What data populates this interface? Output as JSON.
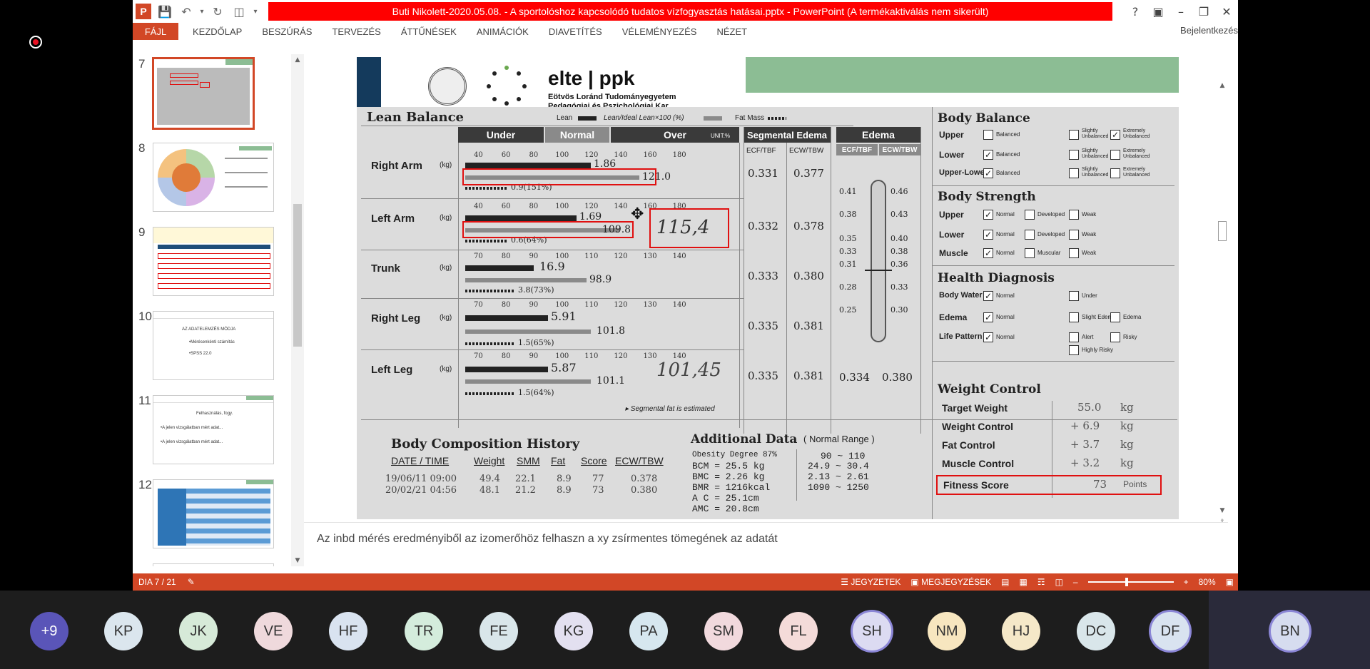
{
  "window": {
    "title": "Buti Nikolett-2020.05.08. - A sportolóshoz kapcsolódó tudatos vízfogyasztás hatásai.pptx - PowerPoint (A termékaktiválás nem sikerült)",
    "help": "?",
    "signin": "Bejelentkezés"
  },
  "ribbon": {
    "tabs": [
      "FÁJL",
      "KEZDŐLAP",
      "BESZÚRÁS",
      "TERVEZÉS",
      "ÁTTŰNÉSEK",
      "ANIMÁCIÓK",
      "DIAVETÍTÉS",
      "VÉLEMÉNYEZÉS",
      "NÉZET"
    ]
  },
  "thumbnails": {
    "numbers": [
      "7",
      "8",
      "9",
      "10",
      "11",
      "12"
    ],
    "slide10_lines": [
      "AZ ADATELEMZÉS MÓDJA",
      "•Mérésenkénti számítás",
      "•SPSS 22.0"
    ],
    "slide11_lines": [
      "Felhasználás, fogy.",
      "•A jelen vizsgálatban mért adat...",
      "•A jelen vizsgálatban mért adat..."
    ]
  },
  "slide": {
    "brand": "elte | ppk",
    "subtitle_1": "Eötvös Loránd Tudományegyetem",
    "subtitle_2": "Pedagógiai és Pszichológiai Kar",
    "lean_balance": "Lean Balance",
    "legend_lean": "Lean",
    "legend_ideal": "Lean/Ideal Lean×100 (%)",
    "legend_fat": "Fat Mass",
    "col_under": "Under",
    "col_normal": "Normal",
    "col_over": "Over",
    "col_unit": "UNIT:%",
    "col_seg_edema": "Segmental Edema",
    "col_edema": "Edema",
    "ecf_tbf": "ECF/TBF",
    "ecw_tbw": "ECW/TBW",
    "segments": [
      {
        "name": "Right Arm",
        "lean": "1.86",
        "pct": "121.0",
        "fat": "0.9(151%)",
        "ecf": "0.331",
        "ecw": "0.377"
      },
      {
        "name": "Left Arm",
        "lean": "1.69",
        "pct": "109.8",
        "fat": "0.6(64%)",
        "ecf": "0.332",
        "ecw": "0.378"
      },
      {
        "name": "Trunk",
        "lean": "16.9",
        "pct": "98.9",
        "fat": "3.8(73%)",
        "ecf": "0.333",
        "ecw": "0.380"
      },
      {
        "name": "Right Leg",
        "lean": "5.91",
        "pct": "101.8",
        "fat": "1.5(65%)",
        "ecf": "0.335",
        "ecw": "0.381"
      },
      {
        "name": "Left Leg",
        "lean": "5.87",
        "pct": "101.1",
        "fat": "1.5(64%)",
        "ecf": "0.335",
        "ecw": "0.381"
      }
    ],
    "kg_unit": "(kg)",
    "tick_scale": [
      "40",
      "60",
      "80",
      "100",
      "120",
      "140",
      "160",
      "180"
    ],
    "trunk_scale": [
      "70",
      "80",
      "90",
      "100",
      "110",
      "120",
      "130",
      "140"
    ],
    "handwritten_1": "115,4",
    "handwritten_2": "101,45",
    "edema_left": [
      "0.41",
      "0.38",
      "0.35",
      "0.33",
      "0.31",
      "0.28",
      "0.25"
    ],
    "edema_right": [
      "0.46",
      "0.43",
      "0.40",
      "0.38",
      "0.36",
      "0.33",
      "0.30"
    ],
    "edema_values": [
      "0.334",
      "0.380"
    ],
    "seg_fat_note": "▸ Segmental fat is estimated",
    "body_balance": "Body Balance",
    "bb_rows": [
      "Upper",
      "Lower",
      "Upper-Lower"
    ],
    "balanced": "Balanced",
    "slightly_unbalanced": "Slightly Unbalanced",
    "extremely_unbalanced": "Extremely Unbalanced",
    "body_strength": "Body Strength",
    "bs_rows": [
      "Upper",
      "Lower",
      "Muscle"
    ],
    "bs_normal": "Normal",
    "bs_developed": "Developed",
    "bs_muscular": "Muscular",
    "bs_weak": "Weak",
    "health_diag": "Health Diagnosis",
    "hd_rows": [
      "Body Water",
      "Edema",
      "Life Pattern"
    ],
    "hd_under": "Under",
    "hd_slight_edema": "Slight Edema",
    "hd_edema": "Edema",
    "hd_alert": "Alert",
    "hd_risky": "Risky",
    "hd_highly": "Highly Risky",
    "history_title": "Body Composition History",
    "history_cols": [
      "DATE / TIME",
      "Weight",
      "SMM",
      "Fat",
      "Score",
      "ECW/TBW"
    ],
    "history_rows": [
      [
        "19/06/11 09:00",
        "49.4",
        "22.1",
        "8.9",
        "77",
        "0.378"
      ],
      [
        "20/02/21 04:56",
        "48.1",
        "21.2",
        "8.9",
        "73",
        "0.380"
      ]
    ],
    "additional_title": "Additional Data",
    "normal_range": "( Normal Range )",
    "additional_rows": [
      [
        "Obesity Degree 87%",
        "90 ~ 110"
      ],
      [
        "BCM = 25.5 kg",
        "24.9 ~ 30.4"
      ],
      [
        "BMC = 2.26 kg",
        "2.13 ~ 2.61"
      ],
      [
        "BMR = 1216kcal",
        "1090 ~ 1250"
      ],
      [
        "A C = 25.1cm",
        ""
      ],
      [
        "AMC = 20.8cm",
        ""
      ]
    ],
    "weight_control": "Weight Control",
    "wc_rows": [
      [
        "Target Weight",
        "55.0",
        "kg"
      ],
      [
        "Weight Control",
        "+ 6.9",
        "kg"
      ],
      [
        "Fat Control",
        "+ 3.7",
        "kg"
      ],
      [
        "Muscle Control",
        "+ 3.2",
        "kg"
      ]
    ],
    "fitness_label": "Fitness Score",
    "fitness_value": "73",
    "fitness_unit": "Points"
  },
  "notes": "Az inbd mérés eredményiből az izomerőhöz felhaszn a xy zsírmentes tömegének az adatát",
  "status": {
    "slide": "DIA 7 / 21",
    "notes_btn": "JEGYZETEK",
    "comments_btn": "MEGJEGYZÉSEK",
    "zoom": "80%"
  },
  "participants": [
    {
      "initials": "+9",
      "color": "#5a55b8",
      "text": "#ffffff",
      "ring": false
    },
    {
      "initials": "KP",
      "color": "#dbe6ee",
      "text": "#333333",
      "ring": false
    },
    {
      "initials": "JK",
      "color": "#d6ead8",
      "text": "#333333",
      "ring": false
    },
    {
      "initials": "VE",
      "color": "#efd9dc",
      "text": "#333333",
      "ring": false
    },
    {
      "initials": "HF",
      "color": "#d9e3f0",
      "text": "#333333",
      "ring": false
    },
    {
      "initials": "TR",
      "color": "#d4ecdc",
      "text": "#333333",
      "ring": false
    },
    {
      "initials": "FE",
      "color": "#d9e6ea",
      "text": "#333333",
      "ring": false
    },
    {
      "initials": "KG",
      "color": "#e3e0f0",
      "text": "#333333",
      "ring": false
    },
    {
      "initials": "PA",
      "color": "#d6e7ef",
      "text": "#333333",
      "ring": false
    },
    {
      "initials": "SM",
      "color": "#f1d9dd",
      "text": "#333333",
      "ring": false
    },
    {
      "initials": "FL",
      "color": "#f4dbd9",
      "text": "#333333",
      "ring": false
    },
    {
      "initials": "SH",
      "color": "#dcdbf2",
      "text": "#333333",
      "ring": true
    },
    {
      "initials": "NM",
      "color": "#f7e6bf",
      "text": "#333333",
      "ring": false
    },
    {
      "initials": "HJ",
      "color": "#f5e8c8",
      "text": "#333333",
      "ring": false
    },
    {
      "initials": "DC",
      "color": "#d9e6ea",
      "text": "#333333",
      "ring": false
    },
    {
      "initials": "DF",
      "color": "#d9e3f0",
      "text": "#333333",
      "ring": true
    },
    {
      "initials": "BN",
      "color": "#d6dcef",
      "text": "#333333",
      "ring": true
    }
  ],
  "colors": {
    "accent": "#d24726",
    "title_red": "#ff0000",
    "green": "#8cbd94",
    "callout_red": "#e01010"
  }
}
